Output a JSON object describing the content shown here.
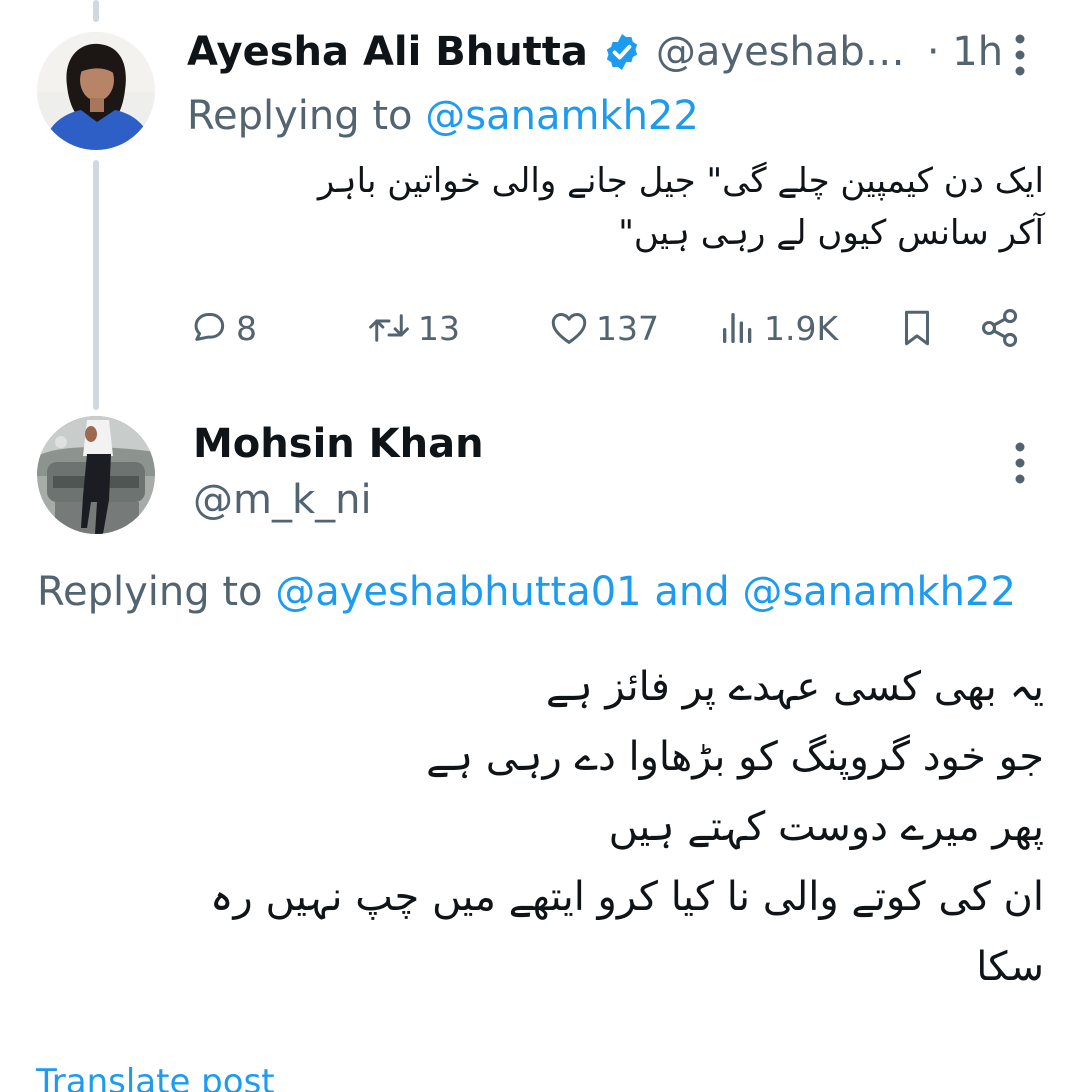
{
  "colors": {
    "text": "#0f1419",
    "secondary": "#536471",
    "accent": "#1d9bf0",
    "thread_line": "#cfd9de"
  },
  "tweet1": {
    "display_name": "Ayesha Ali Bhutta",
    "verified_icon": "verified-badge-icon",
    "handle": "@ayeshab…",
    "time": "· 1h",
    "replying_prefix": "Replying to",
    "replying_handle": "@sanamkh22",
    "text_lines": [
      "ایک دن کیمپین چلے گی\" جیل جانے والی خواتین باہر",
      "آکر سانس کیوں لے رہی ہیں\""
    ],
    "actions": {
      "replies": "8",
      "reposts": "13",
      "likes": "137",
      "views": "1.9K"
    }
  },
  "tweet2": {
    "display_name": "Mohsin Khan",
    "handle": "@m_k_ni",
    "replying_prefix": "Replying to",
    "replying_handle_1": "@ayeshabhutta01",
    "replying_and": "and",
    "replying_handle_2": "@sanamkh22",
    "text_lines": [
      "یہ بھی کسی عہدے پر فائز ہے",
      "جو خود گروپنگ کو بڑھاوا دے رہی ہے",
      "پھر میرے دوست کہتے ہیں",
      "ان کی کوتے والی نا کیا کرو ایتھے میں چپ نہیں رہ",
      "سکا"
    ],
    "translate_label": "Translate post"
  }
}
